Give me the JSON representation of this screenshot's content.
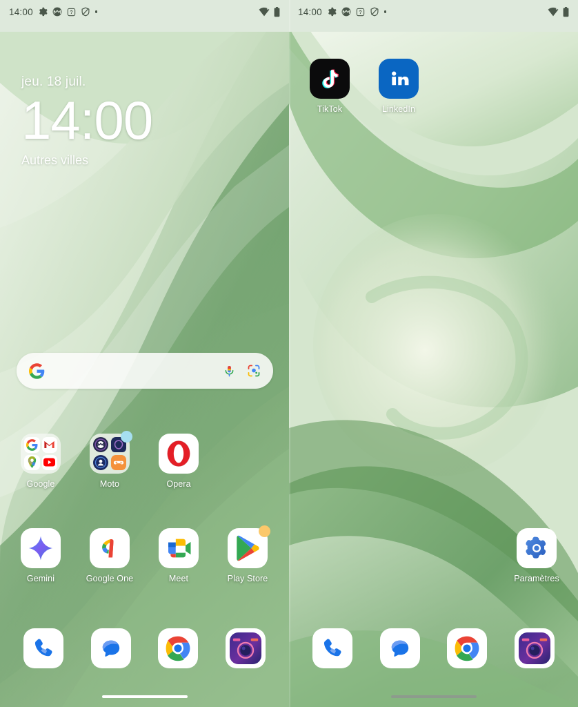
{
  "theme": {
    "background": "#dee9dc",
    "label_color": "#ffffff",
    "status_color": "#4a574a",
    "accent_green": "#5a9a62"
  },
  "status_bar": {
    "time": "14:00",
    "left_icons": [
      "gear-icon",
      "moto-icon",
      "help-box-icon",
      "shield-slash-icon",
      "dot-icon"
    ],
    "right_icons": [
      "wifi-icon",
      "battery-icon"
    ]
  },
  "left_panel": {
    "clock_widget": {
      "date": "jeu. 18 juil.",
      "time": "14:00",
      "subtitle": "Autres villes"
    },
    "search": {
      "google_icon": "google-g-icon",
      "mic_icon": "microphone-icon",
      "lens_icon": "google-lens-icon",
      "placeholder": ""
    },
    "row1": [
      {
        "label": "Google",
        "type": "folder",
        "icons": [
          "google-g-icon",
          "gmail-icon",
          "google-maps-icon",
          "youtube-icon"
        ],
        "badge": ""
      },
      {
        "label": "Moto",
        "type": "folder",
        "icons": [
          "moto-icon",
          "moto-secure-icon",
          "moto-account-icon",
          "moto-gametime-icon"
        ],
        "badge": "blue"
      },
      {
        "label": "Opera",
        "type": "app",
        "icon": "opera-icon",
        "badge": ""
      }
    ],
    "row2": [
      {
        "label": "Gemini",
        "type": "app",
        "icon": "gemini-icon",
        "badge": ""
      },
      {
        "label": "Google One",
        "type": "app",
        "icon": "google-one-icon",
        "badge": ""
      },
      {
        "label": "Meet",
        "type": "app",
        "icon": "google-meet-icon",
        "badge": ""
      },
      {
        "label": "Play Store",
        "type": "app",
        "icon": "play-store-icon",
        "badge": "orange"
      }
    ],
    "dock": [
      {
        "label": "",
        "icon": "phone-icon"
      },
      {
        "label": "",
        "icon": "messages-icon"
      },
      {
        "label": "",
        "icon": "chrome-icon"
      },
      {
        "label": "",
        "icon": "camera-icon"
      }
    ],
    "home_indicator": "bright"
  },
  "right_panel": {
    "row_top": [
      {
        "label": "TikTok",
        "type": "app",
        "icon": "tiktok-icon",
        "badge": ""
      },
      {
        "label": "LinkedIn",
        "type": "app",
        "icon": "linkedin-icon",
        "badge": ""
      }
    ],
    "row_settings": [
      {
        "label": "Paramètres",
        "type": "app",
        "icon": "settings-gear-icon",
        "badge": ""
      }
    ],
    "dock": [
      {
        "label": "",
        "icon": "phone-icon"
      },
      {
        "label": "",
        "icon": "messages-icon"
      },
      {
        "label": "",
        "icon": "chrome-icon"
      },
      {
        "label": "",
        "icon": "camera-icon"
      }
    ],
    "home_indicator": "dim"
  }
}
